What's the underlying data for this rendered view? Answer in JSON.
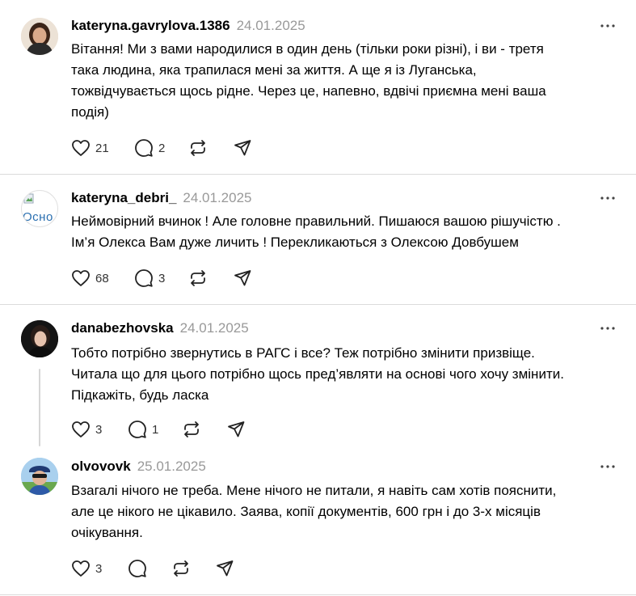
{
  "comments": [
    {
      "username": "kateryna.gavrylova.1386",
      "date": "24.01.2025",
      "text_lines": [
        "Вітання! Ми з вами народилися в один день (тільки роки різні), і ви - третя",
        "така людина, яка трапилася мені за життя. А ще я із Луганська,",
        "тожвідчувається щось рідне. Через це, напевно, вдвічі приємна мені ваша",
        "подія)"
      ],
      "likes": "21",
      "replies": "2",
      "avatar_icon": "profile-photo"
    },
    {
      "username": "kateryna_debri_",
      "date": "24.01.2025",
      "avatar_alt": "Осно",
      "text_lines": [
        "Неймовірний вчинок ! Але головне правильний. Пишаюся вашою рішучістю .",
        "Ім’я Олекса Вам дуже личить ! Перекликаються з Олексою Довбушем"
      ],
      "likes": "68",
      "replies": "3",
      "avatar_icon": "broken-image-icon"
    },
    {
      "username": "danabezhovska",
      "date": "24.01.2025",
      "text_lines": [
        "Тобто потрібно звернутись в РАГС і все? Теж потрібно змінити призвіще.",
        "Читала що для цього потрібно щось пред’являти на основі чого хочу змінити.",
        "Підкажіть, будь ласка"
      ],
      "likes": "3",
      "replies": "1",
      "avatar_icon": "profile-photo"
    },
    {
      "username": "olvovovk",
      "date": "25.01.2025",
      "text_lines": [
        "Взагалі нічого не треба. Мене нічого не питали, я навіть сам хотів пояснити,",
        "але це нікого не цікавило. Заява, копії документів, 600 грн і до 3-х місяців",
        "очікування."
      ],
      "likes": "3",
      "replies": "",
      "avatar_icon": "profile-photo"
    }
  ],
  "colors": {
    "date": "#999999",
    "divider": "#dbdbdb",
    "thread_line": "#d6d6d6"
  },
  "icons": [
    "heart-icon",
    "comment-icon",
    "repost-icon",
    "share-icon",
    "more-icon"
  ]
}
